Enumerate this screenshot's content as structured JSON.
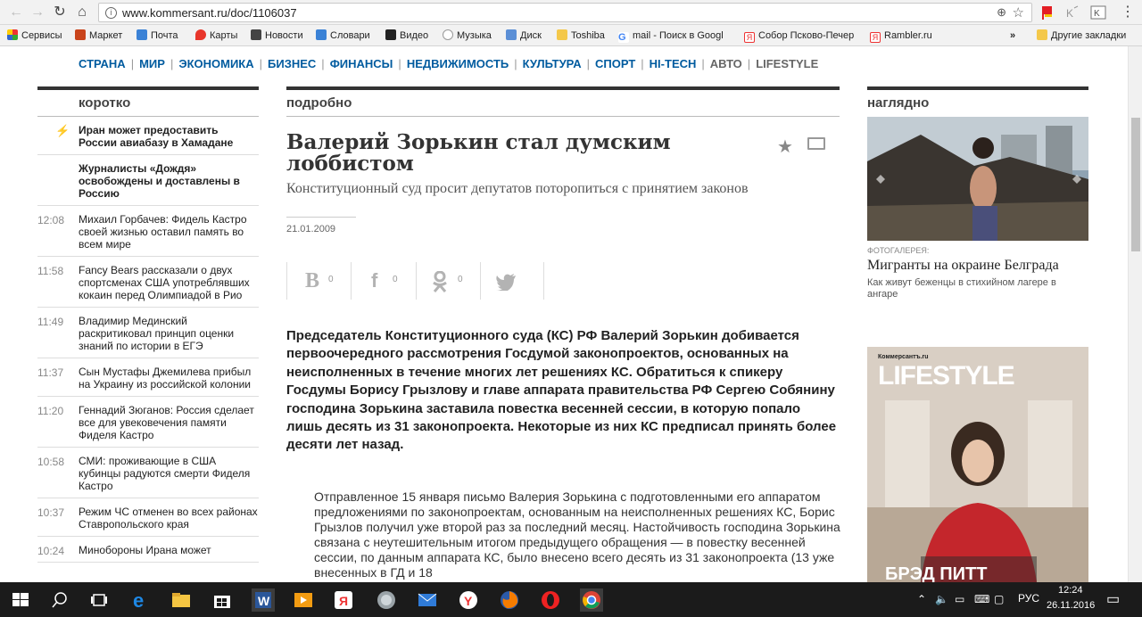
{
  "browser": {
    "url": "www.kommersant.ru/doc/1106037",
    "bookmarks": [
      "Сервисы",
      "Маркет",
      "Почта",
      "Карты",
      "Новости",
      "Словари",
      "Видео",
      "Музыка",
      "Диск",
      "Toshiba",
      "mail - Поиск в Googl",
      "Собор Псково-Печер",
      "Rambler.ru"
    ],
    "more": "»",
    "other_bookmarks": "Другие закладки"
  },
  "site_nav": {
    "items": [
      "СТРАНА",
      "МИР",
      "ЭКОНОМИКА",
      "БИЗНЕС",
      "ФИНАНСЫ",
      "НЕДВИЖИМОСТЬ",
      "КУЛЬТУРА",
      "СПОРТ",
      "HI-TECH",
      "АВТО",
      "LIFESTYLE"
    ]
  },
  "left": {
    "title": "коротко",
    "news": [
      {
        "time": "",
        "text": "Иран может предоставить России авиабазу в Хамадане",
        "bold": true
      },
      {
        "time": "",
        "text": "Журналисты «Дождя» освобождены и доставлены в Россию",
        "bold": true
      },
      {
        "time": "12:08",
        "text": "Михаил Горбачев: Фидель Кастро своей жизнью оставил память во всем мире"
      },
      {
        "time": "11:58",
        "text": "Fancy Bears рассказали о двух спортсменах США употреблявших кокаин перед Олимпиадой в Рио"
      },
      {
        "time": "11:49",
        "text": "Владимир Мединский раскритиковал принцип оценки знаний по истории в ЕГЭ"
      },
      {
        "time": "11:37",
        "text": "Сын Мустафы Джемилева прибыл на Украину из российской колонии"
      },
      {
        "time": "11:20",
        "text": "Геннадий Зюганов: Россия сделает все для увековечения памяти Фиделя Кастро"
      },
      {
        "time": "10:58",
        "text": "СМИ: проживающие в США кубинцы радуются смерти Фиделя Кастро"
      },
      {
        "time": "10:37",
        "text": "Режим ЧС отменен во всех районах Ставропольского края"
      },
      {
        "time": "10:24",
        "text": "Минобороны Ирана может"
      }
    ]
  },
  "center": {
    "title": "подробно",
    "headline": "Валерий Зорькин стал думским лоббистом",
    "subhead": "Конституционный суд просит депутатов поторопиться с принятием законов",
    "date": "21.01.2009",
    "share": [
      {
        "glyph": "В",
        "count": "0"
      },
      {
        "glyph": "f",
        "count": "0"
      },
      {
        "glyph": "ok",
        "count": "0"
      },
      {
        "glyph": "tw",
        "count": ""
      }
    ],
    "lead": "Председатель Конституционного суда (КС) РФ Валерий Зорькин добивается первоочередного рассмотрения Госдумой законопроектов, основанных на неисполненных в течение многих лет решениях КС. Обратиться к спикеру Госдумы Борису Грызлову и главе аппарата правительства РФ Сергею Собянину господина Зорькина заставила повестка весенней сессии, в которую попало лишь десять из 31 законопроекта. Некоторые из них КС предписал принять более десяти лет назад.",
    "body": "Отправленное 15 января письмо Валерия Зорькина с подготовленными его аппаратом предложениями по законопроектам, основанным на неисполненных решениях КС, Борис Грызлов получил уже второй раз за последний месяц. Настойчивость господина Зорькина связана с неутешительным итогом предыдущего обращения — в повестку весенней сессии, по данным аппарата КС, было внесено всего десять из 31 законопроекта (13 уже внесенных в ГД и 18"
  },
  "right": {
    "title": "наглядно",
    "photo_label": "ФОТОГАЛЕРЕЯ:",
    "photo_title": "Мигранты на окраине Белграда",
    "photo_desc": "Как живут беженцы в стихийном лагере в ангаре",
    "ad_brand": "Коммерсантъ.ru",
    "ad_title": "LIFESTYLE",
    "ad_name": "БРЭД ПИТТ"
  },
  "taskbar": {
    "lang": "РУС",
    "time": "12:24",
    "date": "26.11.2016"
  }
}
